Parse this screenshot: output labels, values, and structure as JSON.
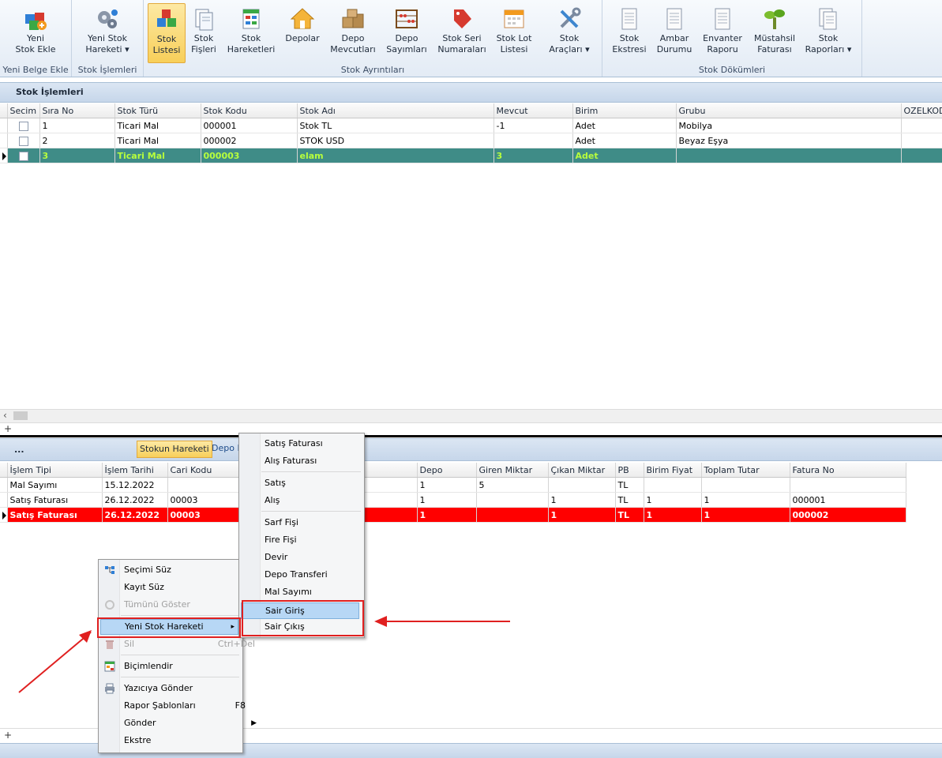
{
  "ribbon": {
    "groups": [
      {
        "label": "Yeni Belge Ekle"
      },
      {
        "label": "Stok İşlemleri"
      },
      {
        "label": "Stok Ayrıntıları"
      },
      {
        "label": "Stok Dökümleri"
      }
    ],
    "buttons": [
      {
        "label": "Yeni\nStok Ekle",
        "icon": "new-stock-icon"
      },
      {
        "label": "Yeni Stok\nHareketi ▾",
        "icon": "gears-icon"
      },
      {
        "label": "Stok\nListesi",
        "icon": "cubes-icon"
      },
      {
        "label": "Stok\nFişleri",
        "icon": "slips-icon"
      },
      {
        "label": "Stok\nHareketleri",
        "icon": "movements-icon"
      },
      {
        "label": "Depolar",
        "icon": "house-icon"
      },
      {
        "label": "Depo\nMevcutları",
        "icon": "boxes-icon"
      },
      {
        "label": "Depo\nSayımları",
        "icon": "abacus-icon"
      },
      {
        "label": "Stok Seri\nNumaraları",
        "icon": "tag-icon"
      },
      {
        "label": "Stok Lot\nListesi",
        "icon": "calendar-icon"
      },
      {
        "label": "Stok\nAraçları ▾",
        "icon": "tools-icon"
      },
      {
        "label": "Stok\nEkstresi",
        "icon": "document-icon"
      },
      {
        "label": "Ambar\nDurumu",
        "icon": "document-icon"
      },
      {
        "label": "Envanter\nRaporu",
        "icon": "document-icon"
      },
      {
        "label": "Müstahsil\nFaturası",
        "icon": "plant-icon"
      },
      {
        "label": "Stok\nRaporları ▾",
        "icon": "documents-icon"
      }
    ],
    "colors": {
      "active_bg": "#f8cf5a"
    }
  },
  "top_panel": {
    "title": "Stok İşlemleri",
    "columns": [
      "Secim",
      "Sıra No",
      "Stok Türü",
      "Stok Kodu",
      "Stok Adı",
      "Mevcut",
      "Birim",
      "Grubu",
      "OZELKOD"
    ],
    "rows": [
      {
        "sira": "1",
        "tur": "Ticari Mal",
        "kod": "000001",
        "ad": "Stok TL",
        "mevcut": "-1",
        "birim": "Adet",
        "grubu": "Mobilya"
      },
      {
        "sira": "2",
        "tur": "Ticari Mal",
        "kod": "000002",
        "ad": "STOK USD",
        "mevcut": "",
        "birim": "Adet",
        "grubu": "Beyaz Eşya"
      },
      {
        "sira": "3",
        "tur": "Ticari Mal",
        "kod": "000003",
        "ad": "elam",
        "mevcut": "3",
        "birim": "Adet",
        "grubu": ""
      }
    ],
    "scroll_left": "‹",
    "footer_plus": "+"
  },
  "bottom_panel": {
    "title": "...",
    "tabs": [
      "Stokun Hareketi",
      "Depo D"
    ],
    "columns": [
      "İşlem Tipi",
      "İşlem Tarihi",
      "Cari Kodu",
      "Depo",
      "Giren Miktar",
      "Çıkan Miktar",
      "PB",
      "Birim Fiyat",
      "Toplam Tutar",
      "Fatura No"
    ],
    "rows": [
      {
        "tip": "Mal Sayımı",
        "tarih": "15.12.2022",
        "cari": "",
        "depo": "1",
        "giren": "5",
        "cikan": "",
        "pb": "TL",
        "fiyat": "",
        "tutar": "",
        "fatura": ""
      },
      {
        "tip": "Satış Faturası",
        "tarih": "26.12.2022",
        "cari": "00003",
        "depo": "1",
        "giren": "",
        "cikan": "1",
        "pb": "TL",
        "fiyat": "1",
        "tutar": "1",
        "fatura": "000001"
      },
      {
        "tip": "Satış Faturası",
        "tarih": "26.12.2022",
        "cari": "00003",
        "depo": "1",
        "giren": "",
        "cikan": "1",
        "pb": "TL",
        "fiyat": "1",
        "tutar": "1",
        "fatura": "000002"
      }
    ],
    "footer_plus": "+"
  },
  "context_menu": {
    "items": [
      {
        "label": "Seçimi Süz",
        "shortcut": "",
        "icon": "filter-icon"
      },
      {
        "label": "Kayıt Süz",
        "shortcut": "",
        "icon": ""
      },
      {
        "label": "Tümünü Göster",
        "shortcut": "",
        "icon": "show-all-icon"
      },
      {
        "label": "Yeni Stok Hareketi",
        "shortcut": "",
        "icon": ""
      },
      {
        "label": "Sil",
        "shortcut": "Ctrl+Del",
        "icon": "delete-icon"
      },
      {
        "label": "Biçimlendir",
        "shortcut": "",
        "icon": "format-icon"
      },
      {
        "label": "Yazıcıya Gönder",
        "shortcut": "",
        "icon": "printer-icon"
      },
      {
        "label": "Rapor Şablonları",
        "shortcut": "F8",
        "icon": ""
      },
      {
        "label": "Gönder",
        "shortcut": "",
        "icon": ""
      },
      {
        "label": "Ekstre",
        "shortcut": "",
        "icon": ""
      }
    ],
    "colors": {
      "highlight": "#b7d7f5"
    }
  },
  "submenu": {
    "items": [
      {
        "label": "Satış Faturası"
      },
      {
        "label": "Alış Faturası"
      },
      {
        "label": "Satış"
      },
      {
        "label": "Alış"
      },
      {
        "label": "Sarf Fişi"
      },
      {
        "label": "Fire Fişi"
      },
      {
        "label": "Devir"
      },
      {
        "label": "Depo Transferi"
      },
      {
        "label": "Mal Sayımı"
      },
      {
        "label": "Sair Giriş"
      },
      {
        "label": "Sair Çıkış"
      }
    ]
  },
  "annotations": {
    "color": "#e02020"
  }
}
